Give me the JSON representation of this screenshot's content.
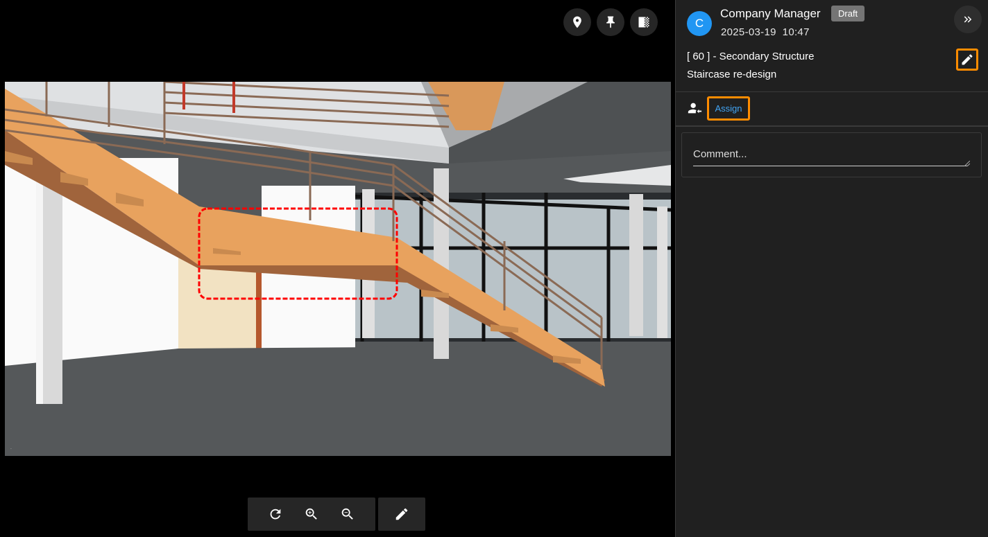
{
  "viewer": {
    "top_tools": [
      {
        "icon": "location-pin-icon"
      },
      {
        "icon": "pin-icon"
      },
      {
        "icon": "checkerboard-icon"
      }
    ],
    "bottom_tools": [
      {
        "icon": "refresh-icon"
      },
      {
        "icon": "zoom-in-icon"
      },
      {
        "icon": "zoom-out-icon"
      },
      {
        "icon": "pencil-icon"
      }
    ],
    "markup_color": "#ff0000"
  },
  "panel": {
    "avatar_letter": "C",
    "author": "Company Manager",
    "status_badge": "Draft",
    "date": "2025-03-19",
    "time": "10:47",
    "issue_number": "[ 60 ] - Secondary Structure",
    "issue_title": "Staircase re-design",
    "assign_label": "Assign",
    "comment_placeholder": "Comment...",
    "accent_color": "#ff8c00",
    "link_color": "#42a5f5",
    "avatar_color": "#2196f3"
  }
}
